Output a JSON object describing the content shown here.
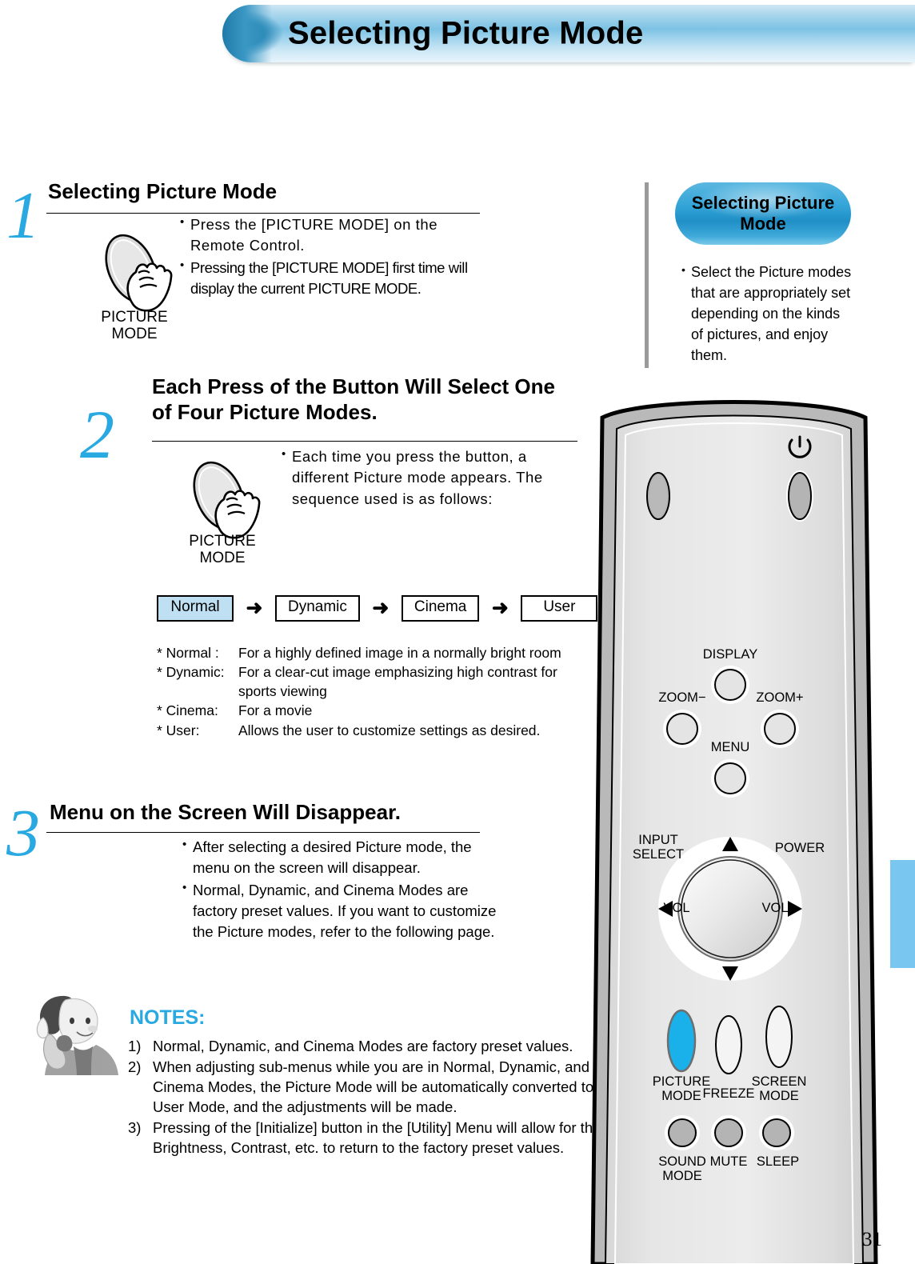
{
  "header": {
    "title": "Selecting Picture Mode"
  },
  "steps": [
    {
      "number": "1",
      "heading": "Selecting Picture Mode",
      "button_label": "PICTURE\nMODE",
      "bullets": [
        "Press the [PICTURE MODE] on the Remote Control.",
        "Pressing the [PICTURE MODE] first time will display the current PICTURE MODE."
      ]
    },
    {
      "number": "2",
      "heading": "Each Press of the Button Will Select One of Four Picture Modes.",
      "button_label": "PICTURE\nMODE",
      "bullets": [
        "Each time you press the button, a different Picture mode appears. The sequence used is as follows:"
      ]
    },
    {
      "number": "3",
      "heading": "Menu on the Screen Will Disappear.",
      "bullets": [
        "After selecting a desired Picture mode, the menu on the screen will disappear.",
        "Normal, Dynamic, and Cinema Modes are factory preset values. If you want to customize the Picture modes, refer to the following page."
      ]
    }
  ],
  "sequence": {
    "arrow": "➜",
    "items": [
      {
        "label": "Normal",
        "highlighted": true
      },
      {
        "label": "Dynamic",
        "highlighted": false
      },
      {
        "label": "Cinema",
        "highlighted": false
      },
      {
        "label": "User",
        "highlighted": false
      }
    ],
    "highlight_color": "#bfe0f2"
  },
  "definitions": [
    {
      "term": "* Normal :",
      "desc": "For a highly defined image in a normally bright room"
    },
    {
      "term": "* Dynamic:",
      "desc": "For a clear-cut image emphasizing high contrast for sports viewing"
    },
    {
      "term": "* Cinema:",
      "desc": "For a movie"
    },
    {
      "term": "* User:",
      "desc": "Allows the user to customize settings as desired."
    }
  ],
  "notes": {
    "title": "NOTES:",
    "title_color": "#29a9e1",
    "items": [
      {
        "num": "1)",
        "text": "Normal, Dynamic, and Cinema Modes are factory preset values."
      },
      {
        "num": "2)",
        "text": "When adjusting sub-menus while you are in Normal, Dynamic, and Cinema Modes, the Picture Mode will be automatically converted to User Mode, and the adjustments will be made."
      },
      {
        "num": "3)",
        "text": "Pressing of the [Initialize] button in the [Utility] Menu will allow for the Brightness, Contrast, etc. to return to the factory preset values."
      }
    ]
  },
  "sidebar": {
    "badge_title": "Selecting Picture Mode",
    "bullet": "Select the Picture modes that are appropriately set depending on the kinds of pictures, and enjoy them."
  },
  "remote": {
    "buttons": [
      {
        "name": "input-select",
        "label": "INPUT\nSELECT"
      },
      {
        "name": "power",
        "label": "POWER"
      },
      {
        "name": "display",
        "label": "DISPLAY"
      },
      {
        "name": "zoom-minus",
        "label": "ZOOM−"
      },
      {
        "name": "zoom-plus",
        "label": "ZOOM+"
      },
      {
        "name": "menu",
        "label": "MENU"
      },
      {
        "name": "vol-left",
        "label": "VOL"
      },
      {
        "name": "vol-right",
        "label": "VOL"
      },
      {
        "name": "picture-mode",
        "label": "PICTURE\nMODE",
        "highlighted": true
      },
      {
        "name": "freeze",
        "label": "FREEZE"
      },
      {
        "name": "screen-mode",
        "label": "SCREEN\nMODE"
      },
      {
        "name": "sound-mode",
        "label": "SOUND\nMODE"
      },
      {
        "name": "mute",
        "label": "MUTE"
      },
      {
        "name": "sleep",
        "label": "SLEEP"
      }
    ],
    "highlight_color": "#1ab0ea"
  },
  "page_number": "31"
}
